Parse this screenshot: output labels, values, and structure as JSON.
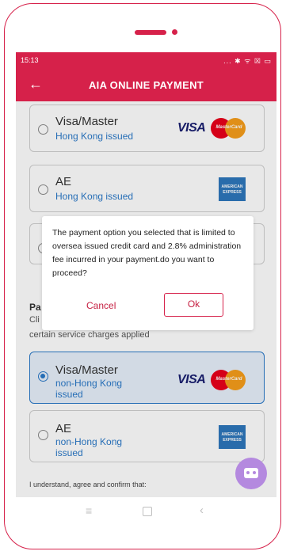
{
  "statusbar": {
    "time": "15:13",
    "icons": "... ✱ ᯤ ☒ ▭"
  },
  "appbar": {
    "back_icon": "←",
    "title": "AIA ONLINE PAYMENT"
  },
  "cards_top": [
    {
      "name": "Visa/Master",
      "sub": "Hong Kong issued",
      "brand": "VISA",
      "mc_text": "MasterCard"
    },
    {
      "name": "AE",
      "sub": "Hong Kong issued",
      "amex_text": "AMERICAN EXPRESS"
    }
  ],
  "section": {
    "title_partial": "Pa",
    "line1_partial": "Cli",
    "line2": "certain service charges applied"
  },
  "cards_bottom": [
    {
      "name": "Visa/Master",
      "sub": "non-Hong Kong issued",
      "brand": "VISA",
      "mc_text": "MasterCard",
      "selected": true
    },
    {
      "name": "AE",
      "sub": "non-Hong Kong issued",
      "amex_text": "AMERICAN EXPRESS"
    }
  ],
  "confirm_text": "I understand, agree and confirm that:",
  "dialog": {
    "message": "The payment option you selected that is limited to oversea issued credit card and 2.8% administration fee incurred in your payment.do you want to proceed?",
    "cancel_label": "Cancel",
    "ok_label": "Ok"
  },
  "navbar": {
    "menu_icon": "≡",
    "back_icon": "‹"
  },
  "colors": {
    "brand": "#d6214a",
    "link": "#2a79c9"
  }
}
